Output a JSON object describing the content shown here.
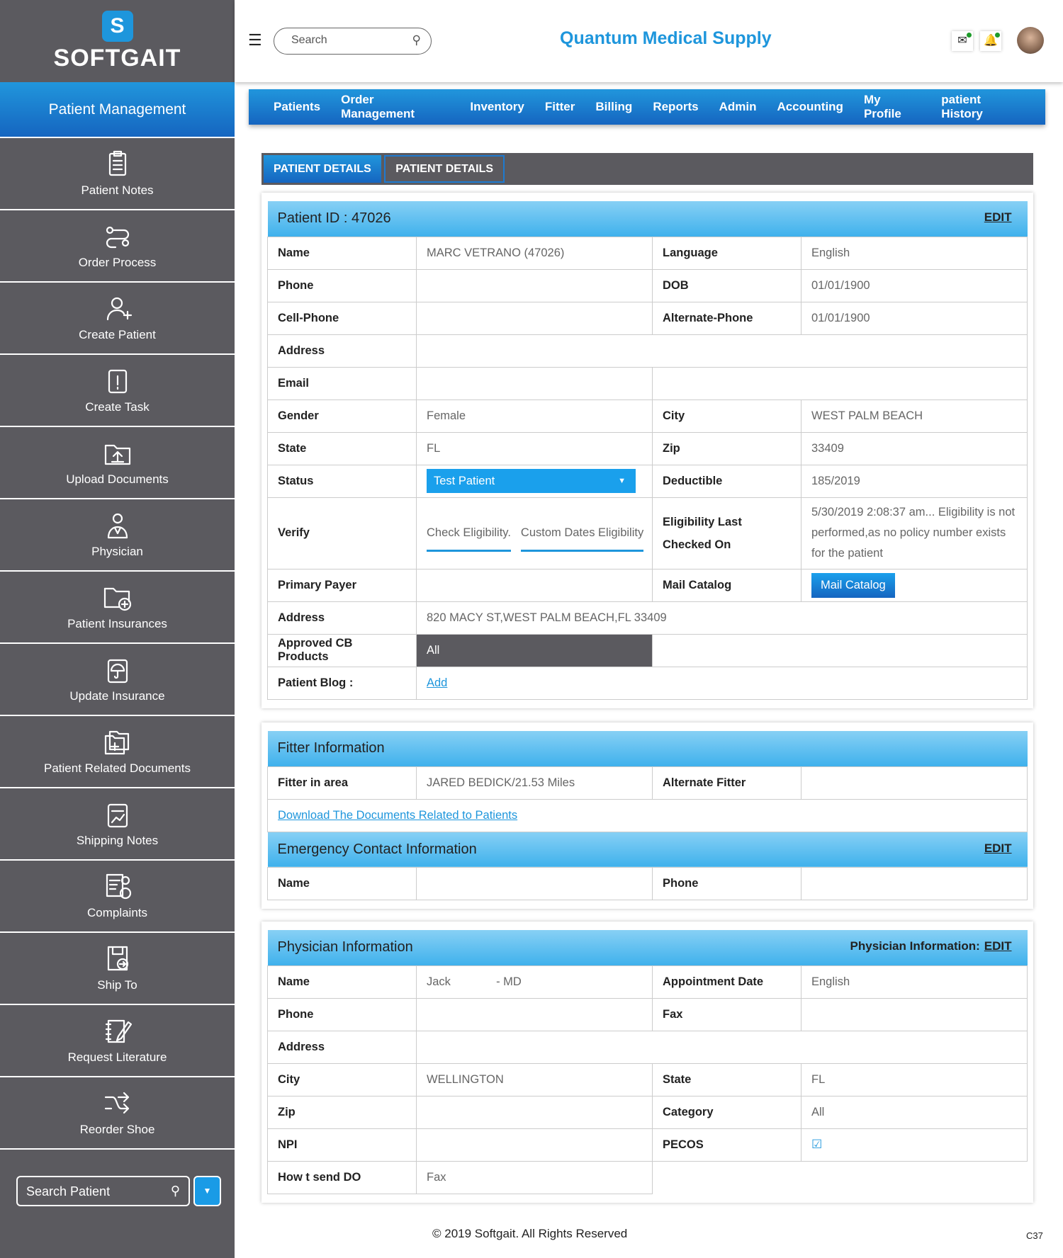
{
  "brand": {
    "logo_letter": "S",
    "logo_text": "SOFTGAIT"
  },
  "sidebar": {
    "title": "Patient Management",
    "items": [
      {
        "label": "Patient Notes",
        "icon": "clipboard-icon"
      },
      {
        "label": "Order Process",
        "icon": "flow-icon"
      },
      {
        "label": "Create Patient",
        "icon": "user-plus-icon"
      },
      {
        "label": "Create Task",
        "icon": "task-alert-icon"
      },
      {
        "label": "Upload Documents",
        "icon": "folder-upload-icon"
      },
      {
        "label": "Physician",
        "icon": "doctor-icon"
      },
      {
        "label": "Patient Insurances",
        "icon": "folder-plus-icon"
      },
      {
        "label": "Update Insurance",
        "icon": "clipboard-umbrella-icon"
      },
      {
        "label": "Patient Related Documents",
        "icon": "folders-icon"
      },
      {
        "label": "Shipping Notes",
        "icon": "clipboard-chart-icon"
      },
      {
        "label": "Complaints",
        "icon": "complaint-icon"
      },
      {
        "label": "Ship To",
        "icon": "ship-to-icon"
      },
      {
        "label": "Request Literature",
        "icon": "notebook-pen-icon"
      },
      {
        "label": "Reorder Shoe",
        "icon": "shuffle-icon"
      }
    ],
    "search_placeholder": "Search Patient"
  },
  "header": {
    "search_placeholder": "Search",
    "title": "Quantum Medical Supply"
  },
  "nav": [
    "Patients",
    "Order Management",
    "Inventory",
    "Fitter",
    "Billing",
    "Reports",
    "Admin",
    "Accounting",
    "My Profile",
    "patient History"
  ],
  "tabs": [
    "PATIENT DETAILS",
    "PATIENT DETAILS"
  ],
  "patient": {
    "header": "Patient ID : 47026",
    "edit": "EDIT",
    "name_l": "Name",
    "name": "MARC VETRANO (47026)",
    "language_l": "Language",
    "language": "English",
    "phone_l": "Phone",
    "phone": "",
    "dob_l": "DOB",
    "dob": "01/01/1900",
    "cell_l": "Cell-Phone",
    "cell": "",
    "alt_phone_l": "Alternate-Phone",
    "alt_phone": "01/01/1900",
    "address_l": "Address",
    "email_l": "Email",
    "gender_l": "Gender",
    "gender": "Female",
    "city_l": "City",
    "city": "WEST PALM BEACH",
    "state_l": "State",
    "state": "FL",
    "zip_l": "Zip",
    "zip": "33409",
    "status_l": "Status",
    "status": "Test Patient",
    "deductible_l": "Deductible",
    "deductible": "185/2019",
    "verify_l": "Verify",
    "check_elig": "Check Eligibility.",
    "custom_elig": "Custom Dates Eligibility",
    "elig_last_l": "Eligibility Last Checked On",
    "elig_last": "5/30/2019 2:08:37 am... Eligibility  is not performed,as no policy number exists for the patient",
    "payer_l": "Primary Payer",
    "mail_l": "Mail Catalog",
    "mail_btn": "Mail Catalog",
    "address2_l": "Address",
    "address2": "820 MACY ST,WEST PALM BEACH,FL 33409",
    "cb_l": "Approved CB Products",
    "cb": "All",
    "blog_l": "Patient Blog :",
    "blog_add": "Add"
  },
  "fitter": {
    "header": "Fitter Information",
    "area_l": "Fitter in area",
    "area": "JARED BEDICK/21.53 Miles",
    "alt_l": "Alternate Fitter",
    "download": "Download The Documents Related to Patients"
  },
  "emergency": {
    "header": "Emergency Contact Information",
    "edit": "EDIT",
    "name_l": "Name",
    "phone_l": "Phone"
  },
  "physician": {
    "header": "Physician Information",
    "edit_label": "Physician Information:",
    "edit": "EDIT",
    "name_l": "Name",
    "name": "Jack              - MD",
    "appt_l": "Appointment Date",
    "appt": "English",
    "phone_l": "Phone",
    "fax_l": "Fax",
    "address_l": "Address",
    "city_l": "City",
    "city": "WELLINGTON",
    "state_l": "State",
    "state": "FL",
    "zip_l": "Zip",
    "category_l": "Category",
    "category": "All",
    "npi_l": "NPI",
    "pecos_l": "PECOS",
    "pecos_checked": true,
    "send_l": "How t send DO",
    "send": "Fax"
  },
  "footer": {
    "copyright": "© 2019 Softgait. All Rights Reserved",
    "code": "C37"
  }
}
